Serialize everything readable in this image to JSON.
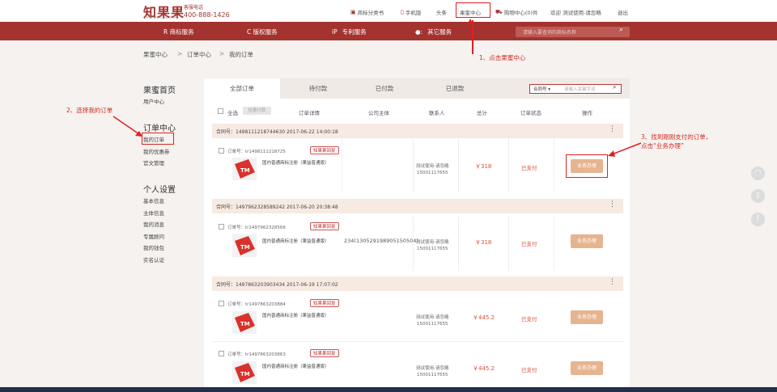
{
  "header": {
    "logo": "知果果",
    "logo_sub": "ZHIGUOGUO.COM",
    "hotline_label": "客服电话",
    "hotline": "400-888-1426",
    "links": [
      "商标分类书",
      "手机版",
      "头条",
      "果蜜中心",
      "购物中心(0)件",
      "欢迎 测试使用-请忽略",
      "退出"
    ]
  },
  "nav": {
    "items": [
      "R  商标服务",
      "C  版权服务",
      "专利服务",
      "其它服务"
    ],
    "icons": [
      "",
      "",
      "iP",
      "●:"
    ],
    "search_placeholder": "请输入要查询的商标名称"
  },
  "breadcrumb": {
    "items": [
      "果蜜中心",
      "订单中心",
      "我的订单"
    ],
    "sep": ">"
  },
  "sidebar": {
    "home": "果蜜首页",
    "home_sub": "用户中心",
    "order_center": "订单中心",
    "order_items": [
      "我的订单",
      "我的优惠券",
      "官文管理"
    ],
    "personal": "个人设置",
    "personal_items": [
      "基本信息",
      "主体信息",
      "我的消息",
      "专属顾问",
      "我的钱包",
      "实名认证"
    ]
  },
  "tabs": [
    "全部订单",
    "待付款",
    "已付款",
    "已退款"
  ],
  "order_search": {
    "type": "合同号",
    "placeholder": "请输入关键字词"
  },
  "columns": {
    "select_all": "全选",
    "batch_btn": "批量付款",
    "headers": [
      "订单详情",
      "公司主体",
      "联系人",
      "总计",
      "订单状态",
      "操作"
    ]
  },
  "orders": [
    {
      "contract": "合同号：1498111218744630 2017-06-22 14:00:18",
      "order_no": "订单号：tr1498111218725",
      "tag": "知果果回复",
      "product": "国内普通商标注册（果益普通版）",
      "entity": "",
      "contact": "测试使用-请忽略",
      "phone": "15001117655",
      "total": "￥318",
      "status": "已支付",
      "action": "业务办理"
    },
    {
      "contract": "合同号：1497962328589242 2017-06-20 20:38:48",
      "order_no": "订单号：tr1497962328568",
      "tag": "知果果回复",
      "product": "国内普通商标注册（果益普通版）",
      "entity": "234(130529198905150504)",
      "contact": "测试使用-请忽略",
      "phone": "15001117655",
      "total": "￥318",
      "status": "已支付",
      "action": "业务办理"
    },
    {
      "contract": "合同号：1497863203903434 2017-06-19 17:07:02",
      "items": [
        {
          "order_no": "订单号：tr1497863203884",
          "tag": "知果果回复",
          "product": "国内普通商标注册（果益普通版）",
          "entity": "",
          "contact": "测试使用-请忽略",
          "phone": "15001117655",
          "total": "￥445.2",
          "status": "已支付",
          "action": "业务办理"
        },
        {
          "order_no": "订单号：tr1497863203863",
          "tag": "知果果回复",
          "product": "国内普通商标注册（果益普通版）",
          "entity": "",
          "contact": "测试使用-请忽略",
          "phone": "15001117655",
          "total": "￥445.2",
          "status": "已支付",
          "action": "业务办理"
        }
      ]
    }
  ],
  "thumb_text": "TM",
  "annotations": {
    "a1": "1、点击果蜜中心",
    "a2": "2、选择我的订单",
    "a3_line1": "3、找到刚刚支付的订单，",
    "a3_line2": "点击“业务办理”"
  },
  "colors": {
    "brand": "#a4332f",
    "annotation": "#e02020",
    "action_button": "#e6b48f",
    "price": "#d94e3a"
  }
}
